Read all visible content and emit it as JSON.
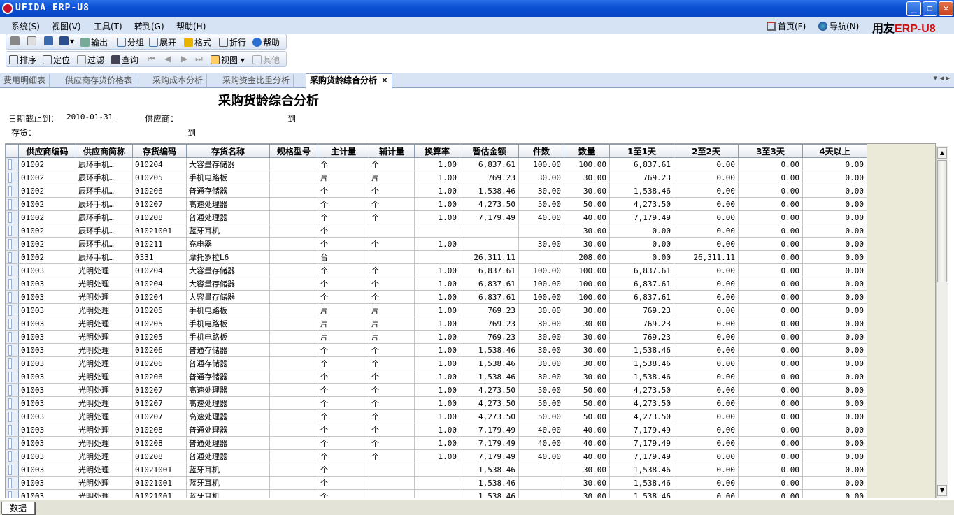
{
  "window": {
    "title": "UFIDA ERP-U8"
  },
  "menu": [
    "系统(S)",
    "视图(V)",
    "工具(T)",
    "转到(G)",
    "帮助(H)"
  ],
  "right_links": {
    "home": "首页(F)",
    "nav": "导航(N)"
  },
  "brand": {
    "part1": "用友",
    "part2": "ERP-U8"
  },
  "toolbar1": [
    "输出",
    "分组",
    "展开",
    "格式",
    "折行",
    "帮助"
  ],
  "toolbar2": {
    "sort": "排序",
    "locate": "定位",
    "filter": "过滤",
    "query": "查询",
    "view": "视图",
    "other": "其他"
  },
  "tabs": [
    "费用明细表",
    "供应商存货价格表",
    "采购成本分析",
    "采购资金比重分析",
    "采购货龄综合分析"
  ],
  "report": {
    "title": "采购货龄综合分析",
    "date_label": "日期截止到：",
    "date_value": "2010-01-31",
    "supplier_label": "供应商：",
    "to1": "到",
    "inventory_label": "存货：",
    "to2": "到"
  },
  "table": {
    "headers": [
      "供应商编码",
      "供应商简称",
      "存货编码",
      "存货名称",
      "规格型号",
      "主计量",
      "辅计量",
      "换算率",
      "暂估金额",
      "件数",
      "数量",
      "1至1天",
      "2至2天",
      "3至3天",
      "4天以上"
    ],
    "rows": [
      [
        "01002",
        "辰环手机…",
        "010204",
        "大容量存储器",
        "",
        "个",
        "个",
        "1.00",
        "6,837.61",
        "100.00",
        "100.00",
        "6,837.61",
        "0.00",
        "0.00",
        "0.00"
      ],
      [
        "01002",
        "辰环手机…",
        "010205",
        "手机电路板",
        "",
        "片",
        "片",
        "1.00",
        "769.23",
        "30.00",
        "30.00",
        "769.23",
        "0.00",
        "0.00",
        "0.00"
      ],
      [
        "01002",
        "辰环手机…",
        "010206",
        "普通存储器",
        "",
        "个",
        "个",
        "1.00",
        "1,538.46",
        "30.00",
        "30.00",
        "1,538.46",
        "0.00",
        "0.00",
        "0.00"
      ],
      [
        "01002",
        "辰环手机…",
        "010207",
        "高速处理器",
        "",
        "个",
        "个",
        "1.00",
        "4,273.50",
        "50.00",
        "50.00",
        "4,273.50",
        "0.00",
        "0.00",
        "0.00"
      ],
      [
        "01002",
        "辰环手机…",
        "010208",
        "普通处理器",
        "",
        "个",
        "个",
        "1.00",
        "7,179.49",
        "40.00",
        "40.00",
        "7,179.49",
        "0.00",
        "0.00",
        "0.00"
      ],
      [
        "01002",
        "辰环手机…",
        "01021001",
        "蓝牙耳机",
        "",
        "个",
        "",
        "",
        "",
        "",
        "30.00",
        "0.00",
        "0.00",
        "0.00",
        "0.00"
      ],
      [
        "01002",
        "辰环手机…",
        "010211",
        "充电器",
        "",
        "个",
        "个",
        "1.00",
        "",
        "30.00",
        "30.00",
        "0.00",
        "0.00",
        "0.00",
        "0.00"
      ],
      [
        "01002",
        "辰环手机…",
        "0331",
        "摩托罗拉L6",
        "",
        "台",
        "",
        "",
        "26,311.11",
        "",
        "208.00",
        "0.00",
        "26,311.11",
        "0.00",
        "0.00"
      ],
      [
        "01003",
        "光明处理",
        "010204",
        "大容量存储器",
        "",
        "个",
        "个",
        "1.00",
        "6,837.61",
        "100.00",
        "100.00",
        "6,837.61",
        "0.00",
        "0.00",
        "0.00"
      ],
      [
        "01003",
        "光明处理",
        "010204",
        "大容量存储器",
        "",
        "个",
        "个",
        "1.00",
        "6,837.61",
        "100.00",
        "100.00",
        "6,837.61",
        "0.00",
        "0.00",
        "0.00"
      ],
      [
        "01003",
        "光明处理",
        "010204",
        "大容量存储器",
        "",
        "个",
        "个",
        "1.00",
        "6,837.61",
        "100.00",
        "100.00",
        "6,837.61",
        "0.00",
        "0.00",
        "0.00"
      ],
      [
        "01003",
        "光明处理",
        "010205",
        "手机电路板",
        "",
        "片",
        "片",
        "1.00",
        "769.23",
        "30.00",
        "30.00",
        "769.23",
        "0.00",
        "0.00",
        "0.00"
      ],
      [
        "01003",
        "光明处理",
        "010205",
        "手机电路板",
        "",
        "片",
        "片",
        "1.00",
        "769.23",
        "30.00",
        "30.00",
        "769.23",
        "0.00",
        "0.00",
        "0.00"
      ],
      [
        "01003",
        "光明处理",
        "010205",
        "手机电路板",
        "",
        "片",
        "片",
        "1.00",
        "769.23",
        "30.00",
        "30.00",
        "769.23",
        "0.00",
        "0.00",
        "0.00"
      ],
      [
        "01003",
        "光明处理",
        "010206",
        "普通存储器",
        "",
        "个",
        "个",
        "1.00",
        "1,538.46",
        "30.00",
        "30.00",
        "1,538.46",
        "0.00",
        "0.00",
        "0.00"
      ],
      [
        "01003",
        "光明处理",
        "010206",
        "普通存储器",
        "",
        "个",
        "个",
        "1.00",
        "1,538.46",
        "30.00",
        "30.00",
        "1,538.46",
        "0.00",
        "0.00",
        "0.00"
      ],
      [
        "01003",
        "光明处理",
        "010206",
        "普通存储器",
        "",
        "个",
        "个",
        "1.00",
        "1,538.46",
        "30.00",
        "30.00",
        "1,538.46",
        "0.00",
        "0.00",
        "0.00"
      ],
      [
        "01003",
        "光明处理",
        "010207",
        "高速处理器",
        "",
        "个",
        "个",
        "1.00",
        "4,273.50",
        "50.00",
        "50.00",
        "4,273.50",
        "0.00",
        "0.00",
        "0.00"
      ],
      [
        "01003",
        "光明处理",
        "010207",
        "高速处理器",
        "",
        "个",
        "个",
        "1.00",
        "4,273.50",
        "50.00",
        "50.00",
        "4,273.50",
        "0.00",
        "0.00",
        "0.00"
      ],
      [
        "01003",
        "光明处理",
        "010207",
        "高速处理器",
        "",
        "个",
        "个",
        "1.00",
        "4,273.50",
        "50.00",
        "50.00",
        "4,273.50",
        "0.00",
        "0.00",
        "0.00"
      ],
      [
        "01003",
        "光明处理",
        "010208",
        "普通处理器",
        "",
        "个",
        "个",
        "1.00",
        "7,179.49",
        "40.00",
        "40.00",
        "7,179.49",
        "0.00",
        "0.00",
        "0.00"
      ],
      [
        "01003",
        "光明处理",
        "010208",
        "普通处理器",
        "",
        "个",
        "个",
        "1.00",
        "7,179.49",
        "40.00",
        "40.00",
        "7,179.49",
        "0.00",
        "0.00",
        "0.00"
      ],
      [
        "01003",
        "光明处理",
        "010208",
        "普通处理器",
        "",
        "个",
        "个",
        "1.00",
        "7,179.49",
        "40.00",
        "40.00",
        "7,179.49",
        "0.00",
        "0.00",
        "0.00"
      ],
      [
        "01003",
        "光明处理",
        "01021001",
        "蓝牙耳机",
        "",
        "个",
        "",
        "",
        "1,538.46",
        "",
        "30.00",
        "1,538.46",
        "0.00",
        "0.00",
        "0.00"
      ],
      [
        "01003",
        "光明处理",
        "01021001",
        "蓝牙耳机",
        "",
        "个",
        "",
        "",
        "1,538.46",
        "",
        "30.00",
        "1,538.46",
        "0.00",
        "0.00",
        "0.00"
      ],
      [
        "01003",
        "光明处理",
        "01021001",
        "蓝牙耳机",
        "",
        "个",
        "",
        "",
        "1,538.46",
        "",
        "30.00",
        "1,538.46",
        "0.00",
        "0.00",
        "0.00"
      ]
    ]
  },
  "status": {
    "data_tab": "数据"
  },
  "colors": {
    "titlebar": "#0a4fd4",
    "brand_red": "#cc1010",
    "menubar": "#d6e3f5"
  }
}
